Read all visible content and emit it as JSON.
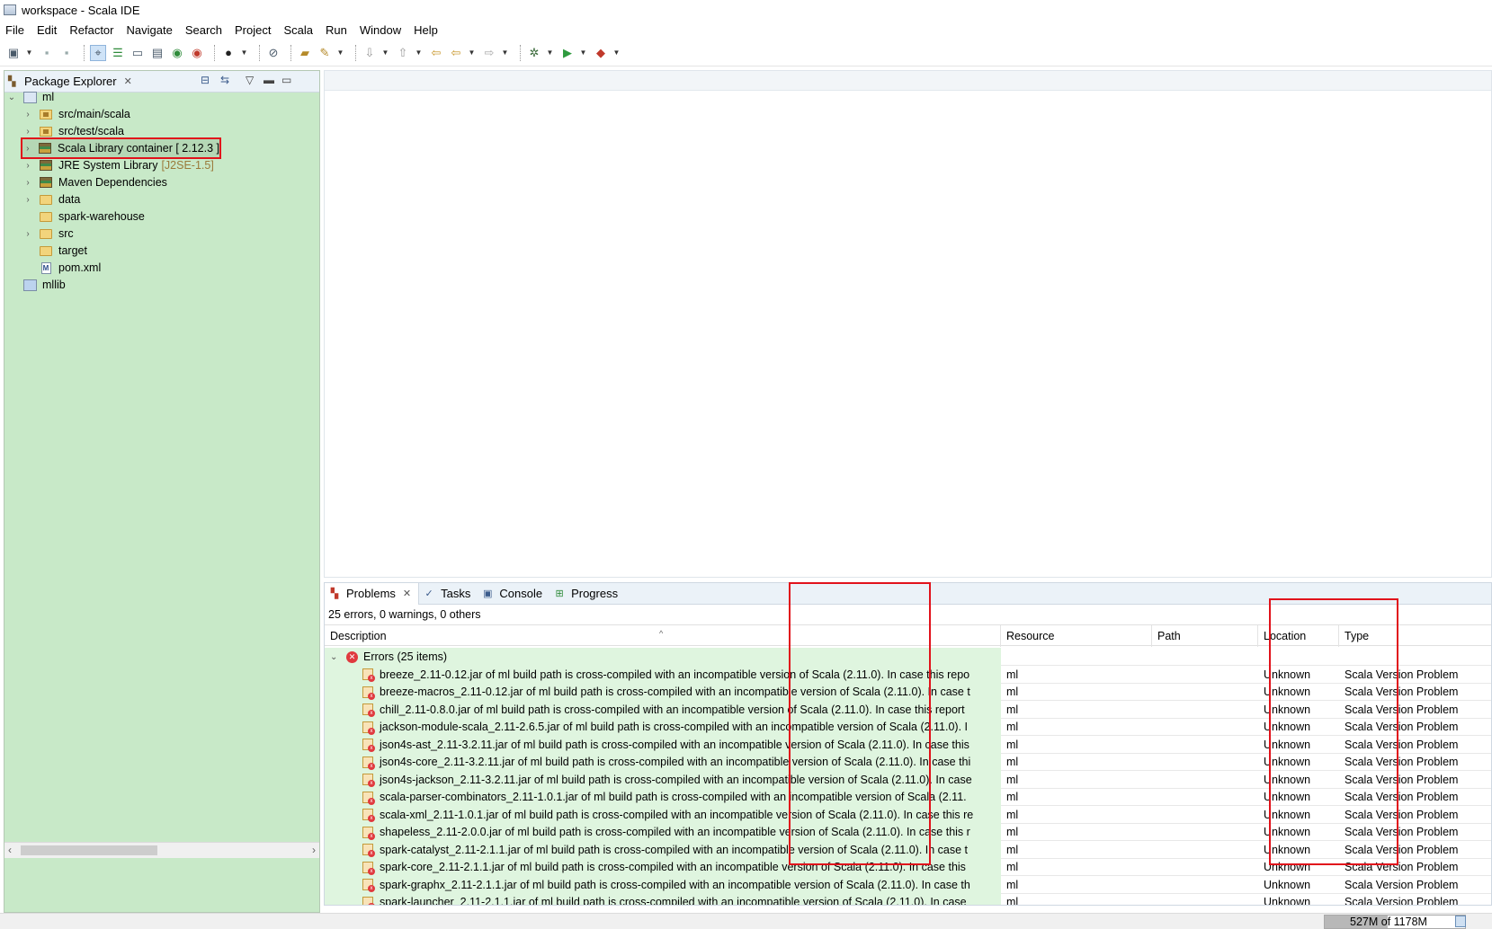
{
  "window": {
    "title": "workspace - Scala IDE"
  },
  "menu": [
    "File",
    "Edit",
    "Refactor",
    "Navigate",
    "Search",
    "Project",
    "Scala",
    "Run",
    "Window",
    "Help"
  ],
  "package_explorer": {
    "tab_label": "Package Explorer",
    "tree": [
      {
        "label": "ml",
        "suffix": ""
      },
      {
        "label": "src/main/scala",
        "suffix": ""
      },
      {
        "label": "src/test/scala",
        "suffix": ""
      },
      {
        "label": "Scala Library container [ 2.12.3 ]",
        "suffix": ""
      },
      {
        "label": "JRE System Library",
        "suffix": "[J2SE-1.5]"
      },
      {
        "label": "Maven Dependencies",
        "suffix": ""
      },
      {
        "label": "data",
        "suffix": ""
      },
      {
        "label": "spark-warehouse",
        "suffix": ""
      },
      {
        "label": "src",
        "suffix": ""
      },
      {
        "label": "target",
        "suffix": ""
      },
      {
        "label": "pom.xml",
        "suffix": ""
      },
      {
        "label": "mllib",
        "suffix": ""
      }
    ]
  },
  "bottom_tabs": [
    "Problems",
    "Tasks",
    "Console",
    "Progress"
  ],
  "problems": {
    "summary": "25 errors, 0 warnings, 0 others",
    "columns": [
      "Description",
      "Resource",
      "Path",
      "Location",
      "Type"
    ],
    "group_label": "Errors (25 items)",
    "rows": [
      {
        "description": "breeze_2.11-0.12.jar of ml build path is cross-compiled with an incompatible version of Scala (2.11.0). In case this repo",
        "resource": "ml",
        "path": "",
        "location": "Unknown",
        "type": "Scala Version Problem"
      },
      {
        "description": "breeze-macros_2.11-0.12.jar of ml build path is cross-compiled with an incompatible version of Scala (2.11.0). In case t",
        "resource": "ml",
        "path": "",
        "location": "Unknown",
        "type": "Scala Version Problem"
      },
      {
        "description": "chill_2.11-0.8.0.jar of ml build path is cross-compiled with an incompatible version of Scala (2.11.0). In case this report",
        "resource": "ml",
        "path": "",
        "location": "Unknown",
        "type": "Scala Version Problem"
      },
      {
        "description": "jackson-module-scala_2.11-2.6.5.jar of ml build path is cross-compiled with an incompatible version of Scala (2.11.0). I",
        "resource": "ml",
        "path": "",
        "location": "Unknown",
        "type": "Scala Version Problem"
      },
      {
        "description": "json4s-ast_2.11-3.2.11.jar of ml build path is cross-compiled with an incompatible version of Scala (2.11.0). In case this",
        "resource": "ml",
        "path": "",
        "location": "Unknown",
        "type": "Scala Version Problem"
      },
      {
        "description": "json4s-core_2.11-3.2.11.jar of ml build path is cross-compiled with an incompatible version of Scala (2.11.0). In case thi",
        "resource": "ml",
        "path": "",
        "location": "Unknown",
        "type": "Scala Version Problem"
      },
      {
        "description": "json4s-jackson_2.11-3.2.11.jar of ml build path is cross-compiled with an incompatible version of Scala (2.11.0). In case",
        "resource": "ml",
        "path": "",
        "location": "Unknown",
        "type": "Scala Version Problem"
      },
      {
        "description": "scala-parser-combinators_2.11-1.0.1.jar of ml build path is cross-compiled with an incompatible version of Scala (2.11.",
        "resource": "ml",
        "path": "",
        "location": "Unknown",
        "type": "Scala Version Problem"
      },
      {
        "description": "scala-xml_2.11-1.0.1.jar of ml build path is cross-compiled with an incompatible version of Scala (2.11.0). In case this re",
        "resource": "ml",
        "path": "",
        "location": "Unknown",
        "type": "Scala Version Problem"
      },
      {
        "description": "shapeless_2.11-2.0.0.jar of ml build path is cross-compiled with an incompatible version of Scala (2.11.0). In case this r",
        "resource": "ml",
        "path": "",
        "location": "Unknown",
        "type": "Scala Version Problem"
      },
      {
        "description": "spark-catalyst_2.11-2.1.1.jar of ml build path is cross-compiled with an incompatible version of Scala (2.11.0). In case t",
        "resource": "ml",
        "path": "",
        "location": "Unknown",
        "type": "Scala Version Problem"
      },
      {
        "description": "spark-core_2.11-2.1.1.jar of ml build path is cross-compiled with an incompatible version of Scala (2.11.0). In case this",
        "resource": "ml",
        "path": "",
        "location": "Unknown",
        "type": "Scala Version Problem"
      },
      {
        "description": "spark-graphx_2.11-2.1.1.jar of ml build path is cross-compiled with an incompatible version of Scala (2.11.0). In case th",
        "resource": "ml",
        "path": "",
        "location": "Unknown",
        "type": "Scala Version Problem"
      },
      {
        "description": "spark-launcher_2.11-2.1.1.jar of ml build path is cross-compiled with an incompatible version of Scala (2.11.0). In case",
        "resource": "ml",
        "path": "",
        "location": "Unknown",
        "type": "Scala Version Problem"
      }
    ]
  },
  "status": {
    "heap": "527M of 1178M",
    "heap_fraction": 0.447
  },
  "colors": {
    "tree_bg": "#c8e9c8",
    "highlight": "#e1121b",
    "error": "#e0393e"
  }
}
